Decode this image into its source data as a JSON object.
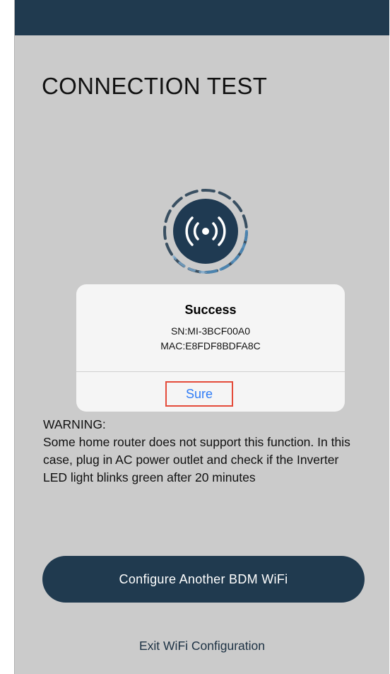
{
  "page": {
    "title": "CONNECTION TEST"
  },
  "colors": {
    "primary": "#203a4f",
    "background": "#cbcbcb",
    "dialog_bg": "#f5f5f5",
    "link_blue": "#2f7cf6",
    "highlight_red": "#e44b3a"
  },
  "signal": {
    "icon": "wifi-broadcast-icon"
  },
  "dialog": {
    "title": "Success",
    "sn": "SN:MI-3BCF00A0",
    "mac": "MAC:E8FDF8BDFA8C",
    "confirm_label": "Sure"
  },
  "warning": {
    "heading": "WARNING:",
    "body": "Some home router does not support this function. In this case, plug in AC power outlet and check if the Inverter LED light blinks green after 20 minutes"
  },
  "actions": {
    "configure_label": "Configure Another BDM WiFi",
    "exit_label": "Exit WiFi Configuration"
  }
}
